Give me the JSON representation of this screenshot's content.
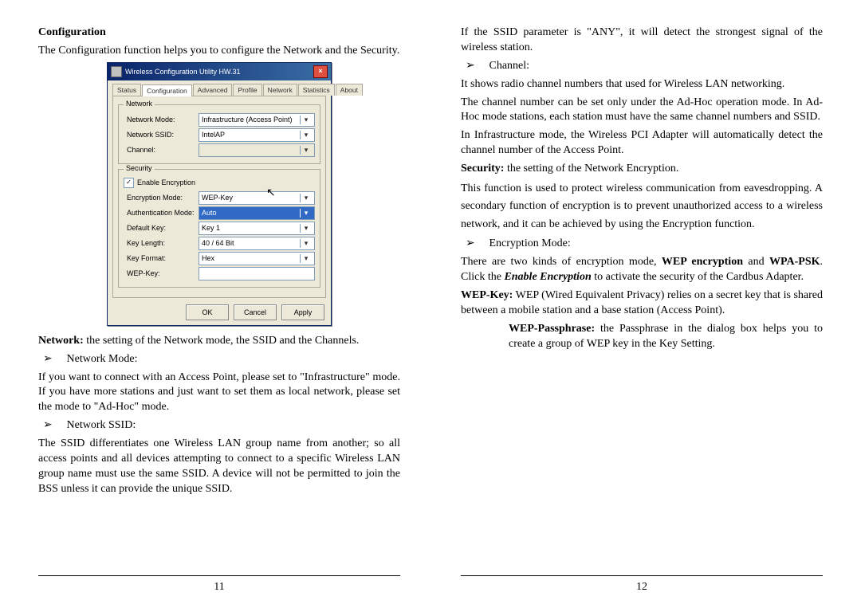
{
  "left": {
    "heading": "Configuration",
    "intro": "The Configuration function helps you to configure the Network and the Security.",
    "network_label": "Network:",
    "network_desc": " the setting of the Network mode, the SSID and the Channels.",
    "b1_label": "Network Mode:",
    "b1_text": "If you want to connect with an Access Point, please set to \"Infrastructure\" mode. If you have more stations and just want to set them as local network, please set the mode to \"Ad-Hoc\" mode.",
    "b2_label": "Network SSID:",
    "b2_text": "The SSID differentiates one Wireless LAN group name from another; so all access points and all devices attempting to connect to a specific Wireless LAN group name must use the same SSID. A device will not be permitted to join the BSS unless it can provide the unique SSID.",
    "page_no": "11"
  },
  "right": {
    "ssid_any": "If the SSID parameter is \"ANY\", it will detect the strongest signal of the wireless station.",
    "ch_label": "Channel:",
    "ch_p1": "It shows radio channel numbers that used for Wireless LAN networking.",
    "ch_p2": "The channel number can be set only under the Ad-Hoc operation mode. In Ad-Hoc mode stations, each station must have the same channel numbers and SSID.",
    "ch_p3": "In Infrastructure mode, the Wireless PCI Adapter will automatically detect the channel number of the Access Point.",
    "sec_label": "Security:",
    "sec_desc": " the setting of the Network Encryption.",
    "sec_p1": "This function is used to protect wireless communication from eavesdropping. A secondary function of encryption is to prevent unauthorized access to a wireless network, and it can be achieved by using the Encryption function.",
    "enc_label": "Encryption Mode:",
    "enc_p1a": "There are two kinds of encryption mode, ",
    "enc_p1b": "WEP encryption",
    "enc_p1c": " and ",
    "enc_p1d": "WPA-PSK",
    "enc_p1e": ". Click the ",
    "enc_p1f": "Enable Encryption",
    "enc_p1g": " to activate the security of the Cardbus Adapter.",
    "wep_label": "WEP-Key:",
    "wep_desc": " WEP (Wired Equivalent Privacy) relies on a secret key that is shared between a mobile station and a base station (Access Point).",
    "wepp_label": "WEP-Passphrase:",
    "wepp_desc": " the Passphrase in the dialog box helps you to create a group of WEP key in the Key Setting.",
    "page_no": "12"
  },
  "dialog": {
    "title": "Wireless Configuration Utility HW.31",
    "tabs": [
      "Status",
      "Configuration",
      "Advanced",
      "Profile",
      "Network",
      "Statistics",
      "About"
    ],
    "grp_network": "Network",
    "grp_security": "Security",
    "rows": {
      "network_mode_l": "Network Mode:",
      "network_mode_v": "Infrastructure (Access Point)",
      "network_ssid_l": "Network SSID:",
      "network_ssid_v": "IntelAP",
      "channel_l": "Channel:",
      "channel_v": "",
      "enable_enc": "Enable Encryption",
      "enc_mode_l": "Encryption Mode:",
      "enc_mode_v": "WEP-Key",
      "auth_mode_l": "Authentication Mode:",
      "auth_mode_v": "Auto",
      "def_key_l": "Default Key:",
      "def_key_v": "Key 1",
      "key_len_l": "Key Length:",
      "key_len_v": "40 / 64 Bit",
      "key_fmt_l": "Key Format:",
      "key_fmt_v": "Hex",
      "wep_key_l": "WEP-Key:",
      "wep_key_v": ""
    },
    "btn_ok": "OK",
    "btn_cancel": "Cancel",
    "btn_apply": "Apply"
  },
  "arrow": "➢"
}
